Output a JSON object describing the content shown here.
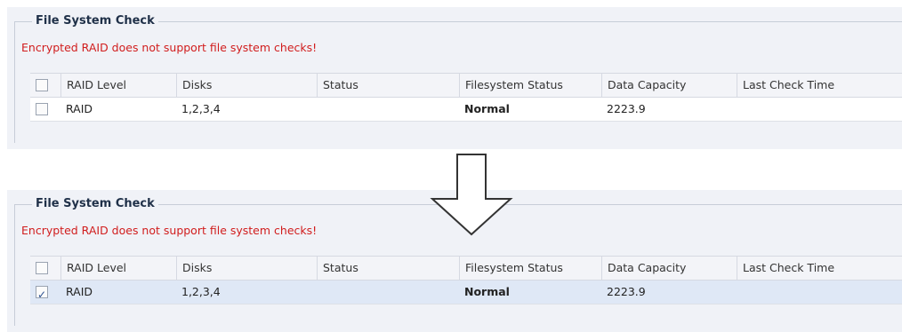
{
  "top": {
    "legend": "File System Check",
    "error": "Encrypted RAID does not support file system checks!",
    "headers": [
      "RAID Level",
      "Disks",
      "Status",
      "Filesystem Status",
      "Data Capacity",
      "Last Check Time"
    ],
    "row": {
      "raid_level": "RAID",
      "disks": "1,2,3,4",
      "status": "",
      "fs_status": "Normal",
      "capacity": "2223.9",
      "last_check": "",
      "checked": false
    }
  },
  "bottom": {
    "legend": "File System Check",
    "error": "Encrypted RAID does not support file system checks!",
    "headers": [
      "RAID Level",
      "Disks",
      "Status",
      "Filesystem Status",
      "Data Capacity",
      "Last Check Time"
    ],
    "row": {
      "raid_level": "RAID",
      "disks": "1,2,3,4",
      "status": "",
      "fs_status": "Normal",
      "capacity": "2223.9",
      "last_check": "",
      "checked": true
    }
  },
  "arrow_icon": "down-arrow-icon"
}
